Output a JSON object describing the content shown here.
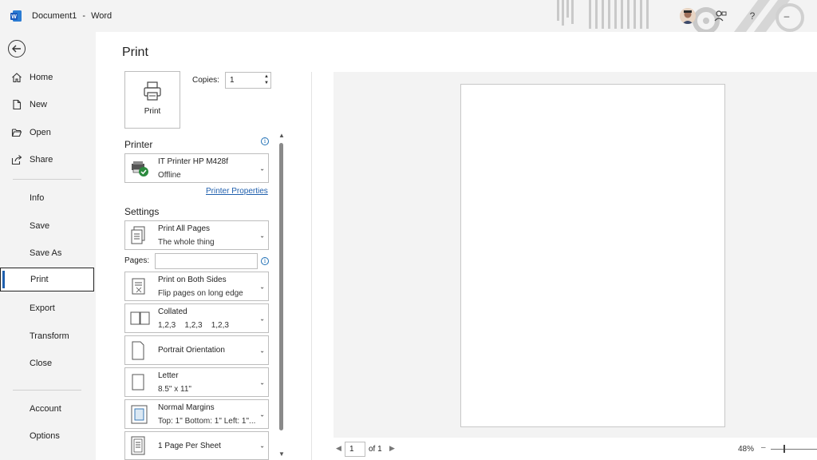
{
  "titlebar": {
    "doc_name": "Document1",
    "separator": "-",
    "app_name": "Word",
    "help_glyph": "?",
    "minimize_glyph": "–"
  },
  "nav": {
    "top_items": [
      {
        "label": "Home",
        "icon": "home-icon"
      },
      {
        "label": "New",
        "icon": "new-doc-icon"
      },
      {
        "label": "Open",
        "icon": "folder-open-icon"
      },
      {
        "label": "Share",
        "icon": "share-icon"
      }
    ],
    "middle_items": [
      "Info",
      "Save",
      "Save As",
      "Print",
      "Export",
      "Transform",
      "Close"
    ],
    "active_item": "Print",
    "bottom_items": [
      "Account",
      "Options"
    ]
  },
  "print_panel": {
    "heading": "Print",
    "print_button_label": "Print",
    "copies_label": "Copies:",
    "copies_value": "1",
    "printer_section": "Printer",
    "printer_name": "IT Printer HP M428f",
    "printer_status": "Offline",
    "printer_properties_link": "Printer Properties",
    "settings_section": "Settings",
    "pages_label": "Pages:",
    "pages_value": "",
    "settings": [
      {
        "line1": "Print All Pages",
        "line2": "The whole thing",
        "icon": "pages-icon"
      },
      {
        "line1": "Print on Both Sides",
        "line2": "Flip pages on long edge",
        "icon": "duplex-icon"
      },
      {
        "line1": "Collated",
        "line2": "1,2,3    1,2,3    1,2,3",
        "icon": "collated-icon"
      },
      {
        "line1": "Portrait Orientation",
        "line2": "",
        "icon": "portrait-icon"
      },
      {
        "line1": "Letter",
        "line2": "8.5\" x 11\"",
        "icon": "paper-size-icon"
      },
      {
        "line1": "Normal Margins",
        "line2": "Top: 1\" Bottom: 1\" Left: 1\"...",
        "icon": "margins-icon"
      },
      {
        "line1": "1 Page Per Sheet",
        "line2": "",
        "icon": "pages-per-sheet-icon"
      }
    ]
  },
  "preview": {
    "current_page": "1",
    "of_label": "of 1",
    "zoom": "48%",
    "zoom_minus": "–",
    "zoom_level": 0.48
  },
  "colors": {
    "accent": "#1f5fad",
    "link": "#1f5fad",
    "status_ok": "#2b8a3e",
    "word_blue": "#185abd"
  }
}
